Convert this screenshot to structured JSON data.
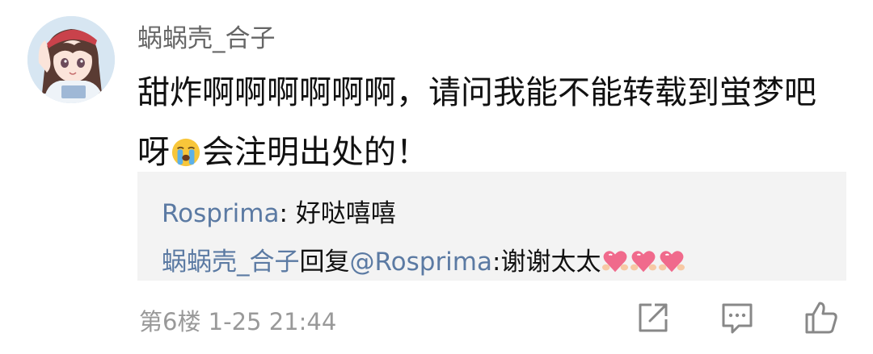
{
  "comment": {
    "username": "蜗蜗壳_合子",
    "content_line1": "甜炸啊啊啊啊啊啊，请问我能不能转载到蛍梦吧",
    "content_line2_before": "呀",
    "content_emoji": "crying-face-emoji",
    "content_line2_after": "会注明出处的！",
    "floor": "第6楼",
    "timestamp": "1-25 21:44"
  },
  "replies": [
    {
      "author": "Rosprima",
      "separator": ": ",
      "text": "好哒嘻嘻"
    },
    {
      "author": "蜗蜗壳_合子",
      "action": "回复",
      "mention": "@Rosprima",
      "separator": ":",
      "text": "谢谢太太",
      "emojis": [
        "heart-emoji",
        "heart-emoji",
        "heart-emoji"
      ]
    }
  ],
  "actions": {
    "share_icon": "share-icon",
    "reply_icon": "comment-icon",
    "like_icon": "thumbs-up-icon"
  },
  "colors": {
    "link": "#5b7aa3",
    "meta": "#999999",
    "reply_bg": "#f3f3f3"
  }
}
